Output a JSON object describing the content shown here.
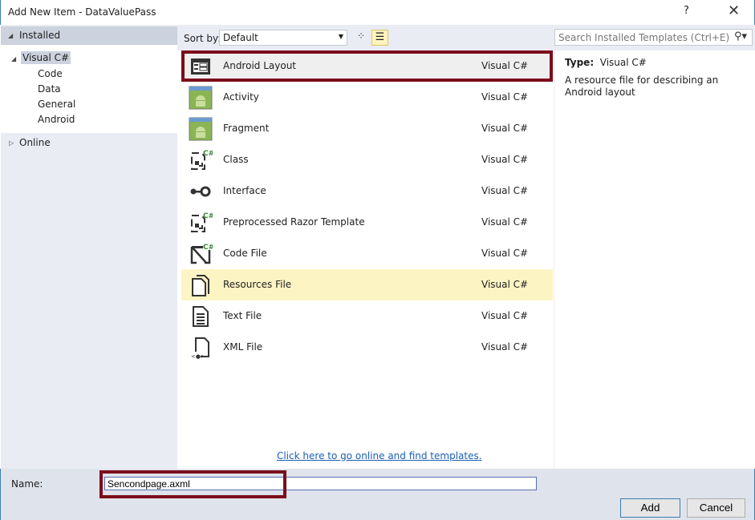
{
  "window": {
    "title": "Add New Item - DataValuePass",
    "help": "?",
    "close": "✕"
  },
  "sidebar": {
    "installed": "Installed",
    "root": "Visual C#",
    "children": [
      "Code",
      "Data",
      "General",
      "Android"
    ],
    "online": "Online"
  },
  "toolbar": {
    "sort_label": "Sort by:",
    "sort_value": "Default"
  },
  "templates": [
    {
      "name": "Android Layout",
      "lang": "Visual C#",
      "icon": "layout-icon"
    },
    {
      "name": "Activity",
      "lang": "Visual C#",
      "icon": "android-icon"
    },
    {
      "name": "Fragment",
      "lang": "Visual C#",
      "icon": "android-icon"
    },
    {
      "name": "Class",
      "lang": "Visual C#",
      "icon": "class-icon"
    },
    {
      "name": "Interface",
      "lang": "Visual C#",
      "icon": "interface-icon"
    },
    {
      "name": "Preprocessed Razor Template",
      "lang": "Visual C#",
      "icon": "class-icon"
    },
    {
      "name": "Code File",
      "lang": "Visual C#",
      "icon": "code-file-icon"
    },
    {
      "name": "Resources File",
      "lang": "Visual C#",
      "icon": "resources-icon"
    },
    {
      "name": "Text File",
      "lang": "Visual C#",
      "icon": "text-file-icon"
    },
    {
      "name": "XML File",
      "lang": "Visual C#",
      "icon": "xml-file-icon"
    }
  ],
  "online_link": "Click here to go online and find templates.",
  "search": {
    "placeholder": "Search Installed Templates (Ctrl+E)"
  },
  "details": {
    "type_label": "Type:",
    "type_value": "Visual C#",
    "description": "A resource file for describing an Android layout"
  },
  "footer": {
    "name_label": "Name:",
    "name_value": "Sencondpage.axml",
    "add": "Add",
    "cancel": "Cancel"
  }
}
